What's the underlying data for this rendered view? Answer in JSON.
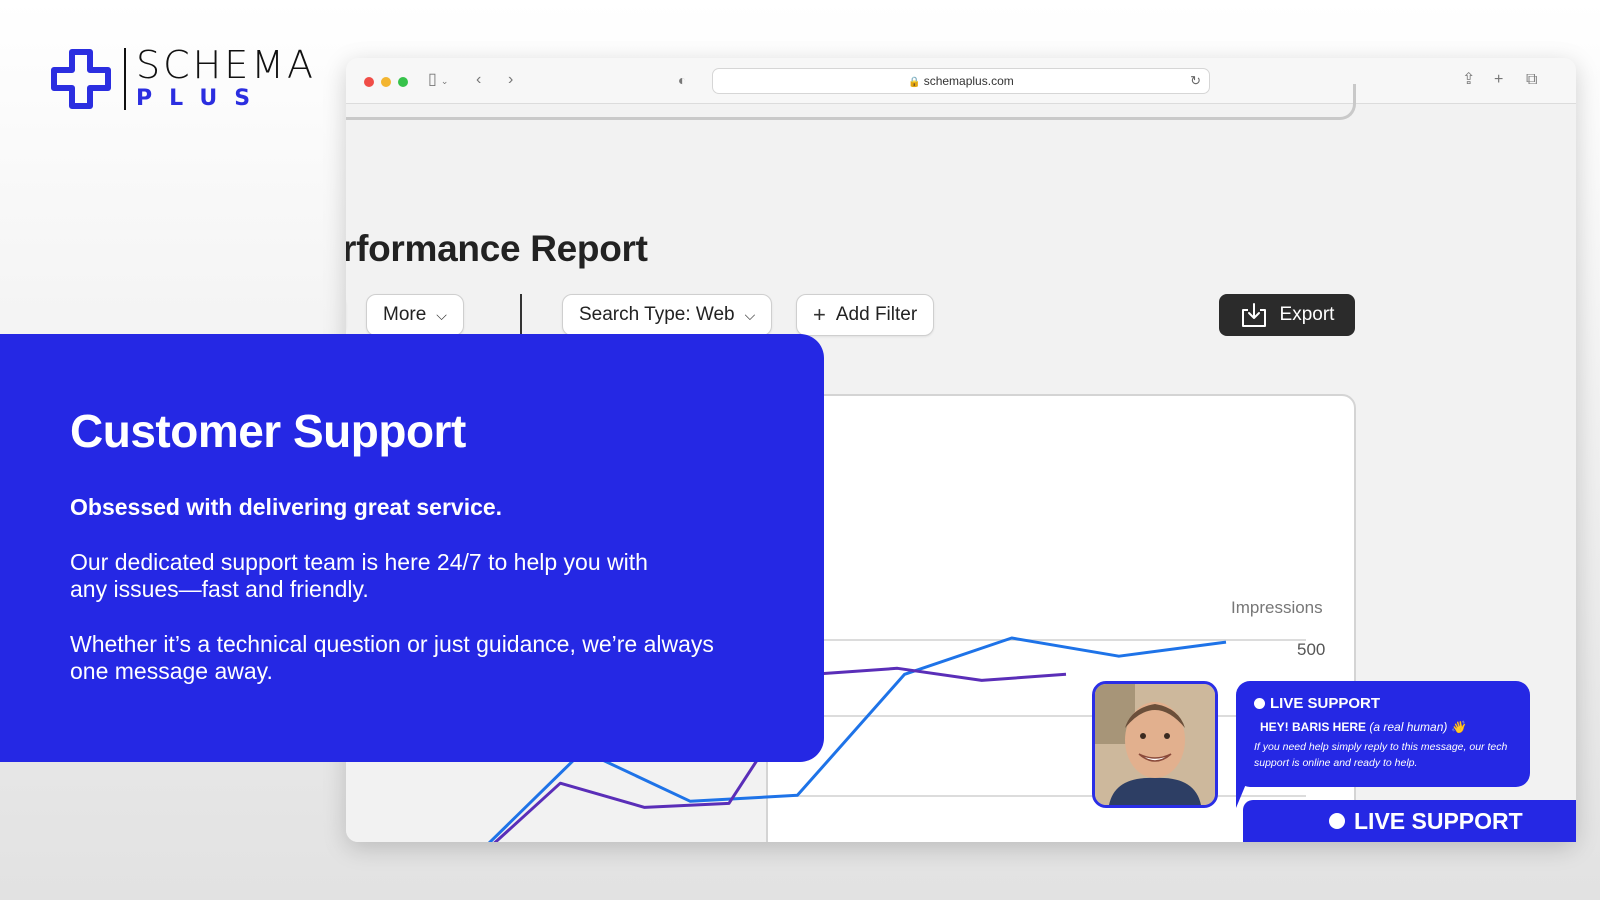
{
  "logo": {
    "word": "SCHEMA",
    "sub": "PLUS"
  },
  "browser": {
    "url": "schemaplus.com"
  },
  "report": {
    "title": "rformance Report",
    "filters": {
      "more_label": "More",
      "search_type_label": "Search Type: Web",
      "add_filter_label": "Add Filter"
    },
    "export_label": "Export"
  },
  "chart_data": {
    "type": "line",
    "ylabel": "Impressions",
    "visible_ticks": [
      "500"
    ],
    "series": [
      {
        "name": "",
        "color": "#1e73e8",
        "values": [
          70,
          330,
          205,
          220,
          520,
          610,
          565,
          600
        ]
      },
      {
        "name": "",
        "color": "#5a2eb8",
        "values": [
          60,
          250,
          190,
          200,
          520,
          535,
          505,
          520
        ]
      }
    ]
  },
  "panel": {
    "title": "Customer Support",
    "lead": "Obsessed with delivering great service.",
    "body1": "Our dedicated support team is here 24/7 to help you with\nany issues—fast and friendly.",
    "body2": "Whether it’s a technical question or just guidance, we’re always\none message away."
  },
  "live_support": {
    "status": "LIVE SUPPORT",
    "greeting": "HEY! BARIS HERE",
    "greeting_note": "(a real human) 👋",
    "message": "If you need help simply reply to this message, our tech support is online and ready to help.",
    "bar_label": "LIVE SUPPORT"
  },
  "colors": {
    "brand_blue": "#2528e4",
    "export_bg": "#2b2b2b"
  }
}
